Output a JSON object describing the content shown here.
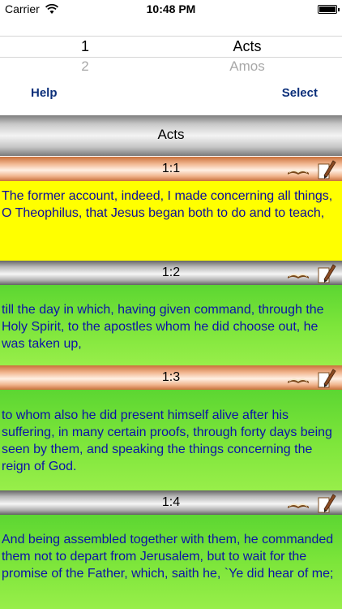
{
  "status_bar": {
    "carrier": "Carrier",
    "time": "10:48 PM"
  },
  "picker": {
    "selected": {
      "chapter": "1",
      "book": "Acts"
    },
    "next": {
      "chapter": "2",
      "book": "Amos"
    }
  },
  "actions": {
    "help": "Help",
    "select": "Select"
  },
  "book_title": "Acts",
  "verses": [
    {
      "ref": "1:1",
      "text": "The former account, indeed, I made concerning all things, O Theophilus, that Jesus began both to do and to teach,"
    },
    {
      "ref": "1:2",
      "text": "till the day in which, having given command, through the Holy Spirit, to the apostles whom he did choose out, he was taken up,"
    },
    {
      "ref": "1:3",
      "text": "to whom also he did present himself alive after his suffering, in many certain proofs, through forty days being seen by them, and speaking the things concerning the reign of God."
    },
    {
      "ref": "1:4",
      "text": "And being assembled together with them, he commanded them not to depart from Jerusalem, but to wait for the promise of the Father, which, saith he, `Ye did hear of me;"
    }
  ],
  "colors": {
    "highlight": "#ffff00",
    "verse_green": "#7ce53a",
    "verse_text": "#0a0aa0",
    "action_text": "#0b2f7a"
  },
  "icons": {
    "wifi": "wifi-icon",
    "battery": "battery-icon",
    "book": "open-book-icon",
    "pen": "pen-icon"
  }
}
